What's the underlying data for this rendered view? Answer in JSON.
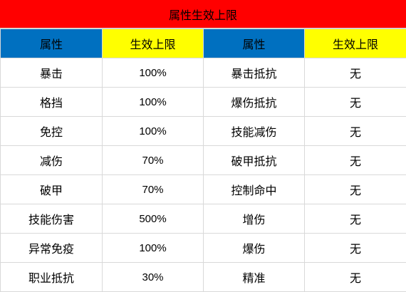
{
  "title": "属性生效上限",
  "header": {
    "col1": "属性",
    "col2": "生效上限",
    "col3": "属性",
    "col4": "生效上限"
  },
  "colors": {
    "title_bg": "#ff0000",
    "header_blue": "#0070c0",
    "header_yellow": "#ffff00"
  },
  "rows": [
    {
      "a": "暴击",
      "a_limit": "100%",
      "b": "暴击抵抗",
      "b_limit": "无"
    },
    {
      "a": "格挡",
      "a_limit": "100%",
      "b": "爆伤抵抗",
      "b_limit": "无"
    },
    {
      "a": "免控",
      "a_limit": "100%",
      "b": "技能减伤",
      "b_limit": "无"
    },
    {
      "a": "减伤",
      "a_limit": "70%",
      "b": "破甲抵抗",
      "b_limit": "无"
    },
    {
      "a": "破甲",
      "a_limit": "70%",
      "b": "控制命中",
      "b_limit": "无"
    },
    {
      "a": "技能伤害",
      "a_limit": "500%",
      "b": "增伤",
      "b_limit": "无"
    },
    {
      "a": "异常免疫",
      "a_limit": "100%",
      "b": "爆伤",
      "b_limit": "无"
    },
    {
      "a": "职业抵抗",
      "a_limit": "30%",
      "b": "精准",
      "b_limit": "无"
    }
  ]
}
